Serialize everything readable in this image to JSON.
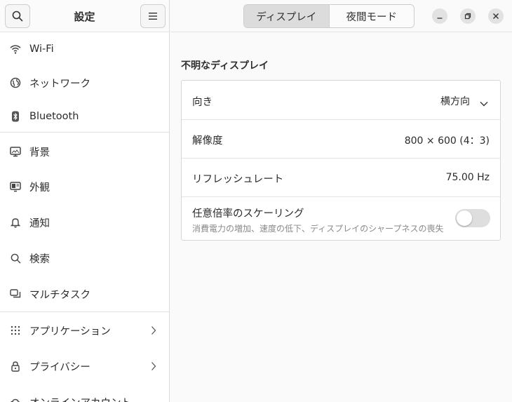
{
  "sidebar": {
    "title": "設定",
    "search_icon": "search-icon",
    "menu_icon": "hamburger-menu-icon",
    "items": [
      {
        "label": "Wi-Fi",
        "icon": "wifi-icon"
      },
      {
        "label": "ネットワーク",
        "icon": "globe-icon"
      },
      {
        "label": "Bluetooth",
        "icon": "bluetooth-icon"
      },
      {
        "label": "背景",
        "icon": "monitor-icon"
      },
      {
        "label": "外観",
        "icon": "appearance-icon"
      },
      {
        "label": "通知",
        "icon": "bell-icon"
      },
      {
        "label": "検索",
        "icon": "search-icon"
      },
      {
        "label": "マルチタスク",
        "icon": "multitask-icon"
      },
      {
        "label": "アプリケーション",
        "icon": "grid-dots-icon",
        "has_submenu": true
      },
      {
        "label": "プライバシー",
        "icon": "lock-icon",
        "has_submenu": true
      },
      {
        "label": "オンラインアカウント",
        "icon": "cloud-icon"
      }
    ]
  },
  "header": {
    "tabs": [
      {
        "label": "ディスプレイ",
        "active": true
      },
      {
        "label": "夜間モード",
        "active": false
      }
    ],
    "window_controls": [
      "minimize-icon",
      "restore-icon",
      "close-icon"
    ]
  },
  "display": {
    "group_title": "不明なディスプレイ",
    "rows": [
      {
        "label": "向き",
        "value": "横方向"
      },
      {
        "label": "解像度",
        "value": "800 × 600 (4：3)"
      },
      {
        "label": "リフレッシュレート",
        "value": "75.00 Hz"
      },
      {
        "label": "任意倍率のスケーリング",
        "subtitle": "消費電力の増加、速度の低下、ディスプレイのシャープネスの喪失",
        "toggle_on": false
      }
    ]
  },
  "colors": {
    "accent_active_tab": "#dcdcdc",
    "toggle_off": "#dedede"
  }
}
